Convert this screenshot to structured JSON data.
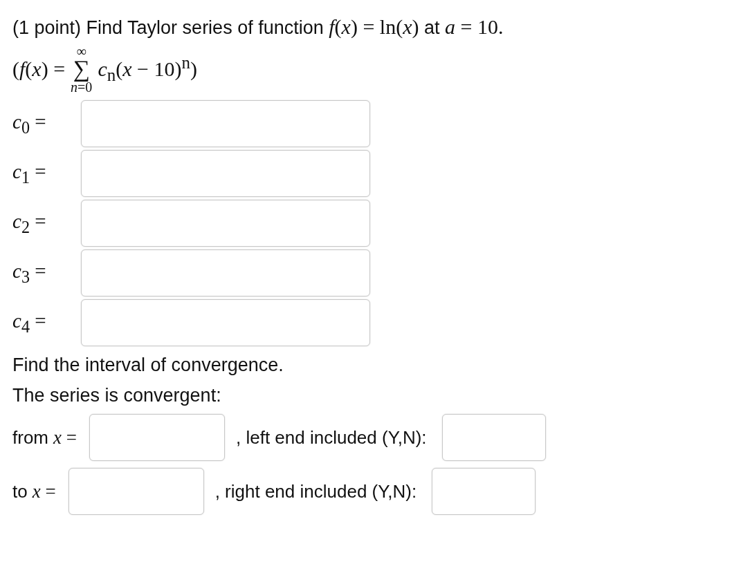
{
  "prompt": [
    {
      "kind": "text",
      "text": "(1 point) Find Taylor series of function "
    },
    {
      "kind": "math",
      "text": "*f*(*x*) = ln(*x*)"
    },
    {
      "kind": "text",
      "text": " at "
    },
    {
      "kind": "math",
      "text": "*a* = 10."
    }
  ],
  "formula": {
    "lhs": "(*f*(*x*) =",
    "sum_sign": "∑",
    "upper": "∞",
    "lower": "*n*=0",
    "body": "*c*$_{n}$(*x* − 10)$^{n}$)"
  },
  "coefficients": [
    {
      "label": "*c*$_{0}$ ="
    },
    {
      "label": "*c*$_{1}$ ="
    },
    {
      "label": "*c*$_{2}$ ="
    },
    {
      "label": "*c*$_{3}$ ="
    },
    {
      "label": "*c*$_{4}$ ="
    }
  ],
  "interval_heading": "Find the interval of convergence.",
  "convergent_text": "The series is convergent:",
  "endpoints": [
    {
      "label_text": "from ",
      "label_math": "*x* =",
      "end_text": ", left end included (Y,N):"
    },
    {
      "label_text": "to ",
      "label_math": "*x* =",
      "end_text": ", right end included (Y,N):"
    }
  ]
}
